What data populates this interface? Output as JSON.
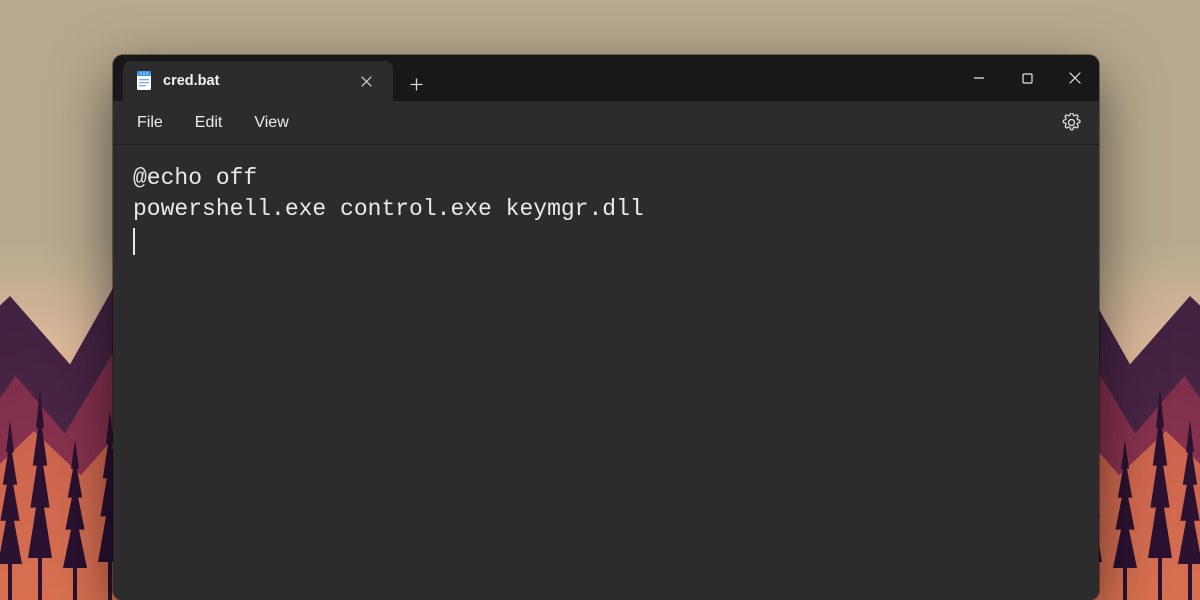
{
  "window": {
    "tab_title": "cred.bat",
    "menus": {
      "file": "File",
      "edit": "Edit",
      "view": "View"
    }
  },
  "editor": {
    "content": "@echo off\npowershell.exe control.exe keymgr.dll"
  },
  "icons": {
    "app": "notepad-icon",
    "close_tab": "close-icon",
    "new_tab": "plus-icon",
    "minimize": "minimize-icon",
    "maximize": "maximize-icon",
    "close_window": "close-icon",
    "settings": "gear-icon"
  }
}
